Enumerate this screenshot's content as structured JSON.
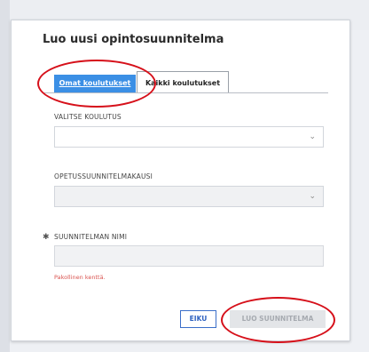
{
  "dialog": {
    "title": "Luo uusi opintosuunnitelma",
    "tabs": [
      {
        "label": "Omat koulutukset",
        "active": true
      },
      {
        "label": "Kaikki koulutukset",
        "active": false
      }
    ],
    "fields": {
      "education": {
        "label": "VALITSE KOULUTUS",
        "value": ""
      },
      "curriculum_term": {
        "label": "OPETUSSUUNNITELMAKAUSI",
        "value": ""
      },
      "plan_name": {
        "label": "SUUNNITELMAN NIMI",
        "required_mark": "✱",
        "value": "",
        "error": "Pakollinen kenttä."
      }
    },
    "buttons": {
      "cancel": "EIKU",
      "create": "LUO SUUNNITELMA"
    }
  },
  "icons": {
    "chevron": "⌄"
  },
  "colors": {
    "accent": "#3b8fe5",
    "error": "#d9534f",
    "annotation": "#d6101a"
  }
}
